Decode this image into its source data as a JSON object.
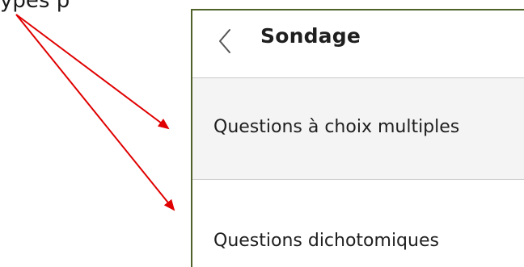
{
  "caption": {
    "text": "ypes p"
  },
  "panel": {
    "back_icon": "chevron-left-icon",
    "title": "Sondage",
    "items": [
      {
        "label": "Questions à choix multiples"
      },
      {
        "label": "Questions dichotomiques"
      }
    ]
  },
  "colors": {
    "panel_border": "#4f6228",
    "arrow": "#e00000",
    "item_selected_bg": "#f4f4f4",
    "divider": "#c9c9c9",
    "text": "#1f1f1f"
  },
  "annotations": {
    "arrow_count": 2,
    "arrow_targets": [
      "Questions à choix multiples",
      "Questions dichotomiques"
    ]
  }
}
